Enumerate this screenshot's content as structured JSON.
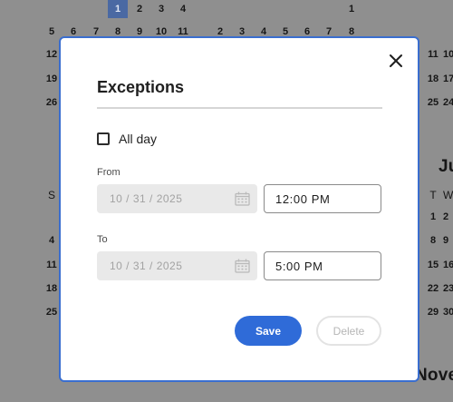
{
  "background_calendar": {
    "top_row_left": [
      "1",
      "2",
      "3",
      "4"
    ],
    "top_row_right": "1",
    "week_row_1": [
      "5",
      "6",
      "7",
      "8",
      "9",
      "10",
      "11",
      "2",
      "3",
      "4",
      "5",
      "6",
      "7",
      "8"
    ],
    "left_col_numbers": [
      "12",
      "19",
      "26"
    ],
    "right_col_numbers_top": [
      "11",
      "18",
      "25"
    ],
    "right_partial_numbers_top": [
      "10",
      "17",
      "24"
    ],
    "right_month_label": "Ju",
    "left_day_head": "S",
    "right_day_heads": [
      "T",
      "W"
    ],
    "left_col_lower": [
      "4",
      "11",
      "18",
      "25"
    ],
    "right_lower_t": [
      "1",
      "8",
      "15",
      "22",
      "29"
    ],
    "right_lower_w": [
      "2",
      "9",
      "16",
      "23",
      "30"
    ],
    "bottom_month_label": "Nove"
  },
  "modal": {
    "title": "Exceptions",
    "all_day_label": "All day",
    "all_day_checked": false,
    "from_label": "From",
    "from_date": "10 / 31 / 2025",
    "from_time": "12:00 PM",
    "to_label": "To",
    "to_date": "10 / 31 / 2025",
    "to_time": "5:00 PM",
    "save_label": "Save",
    "delete_label": "Delete"
  },
  "colors": {
    "accent": "#2f6bd8",
    "modal_border": "#3a6ecf",
    "overlay": "#8f8f8f"
  },
  "icons": {
    "close": "close-icon",
    "calendar": "calendar-icon"
  }
}
